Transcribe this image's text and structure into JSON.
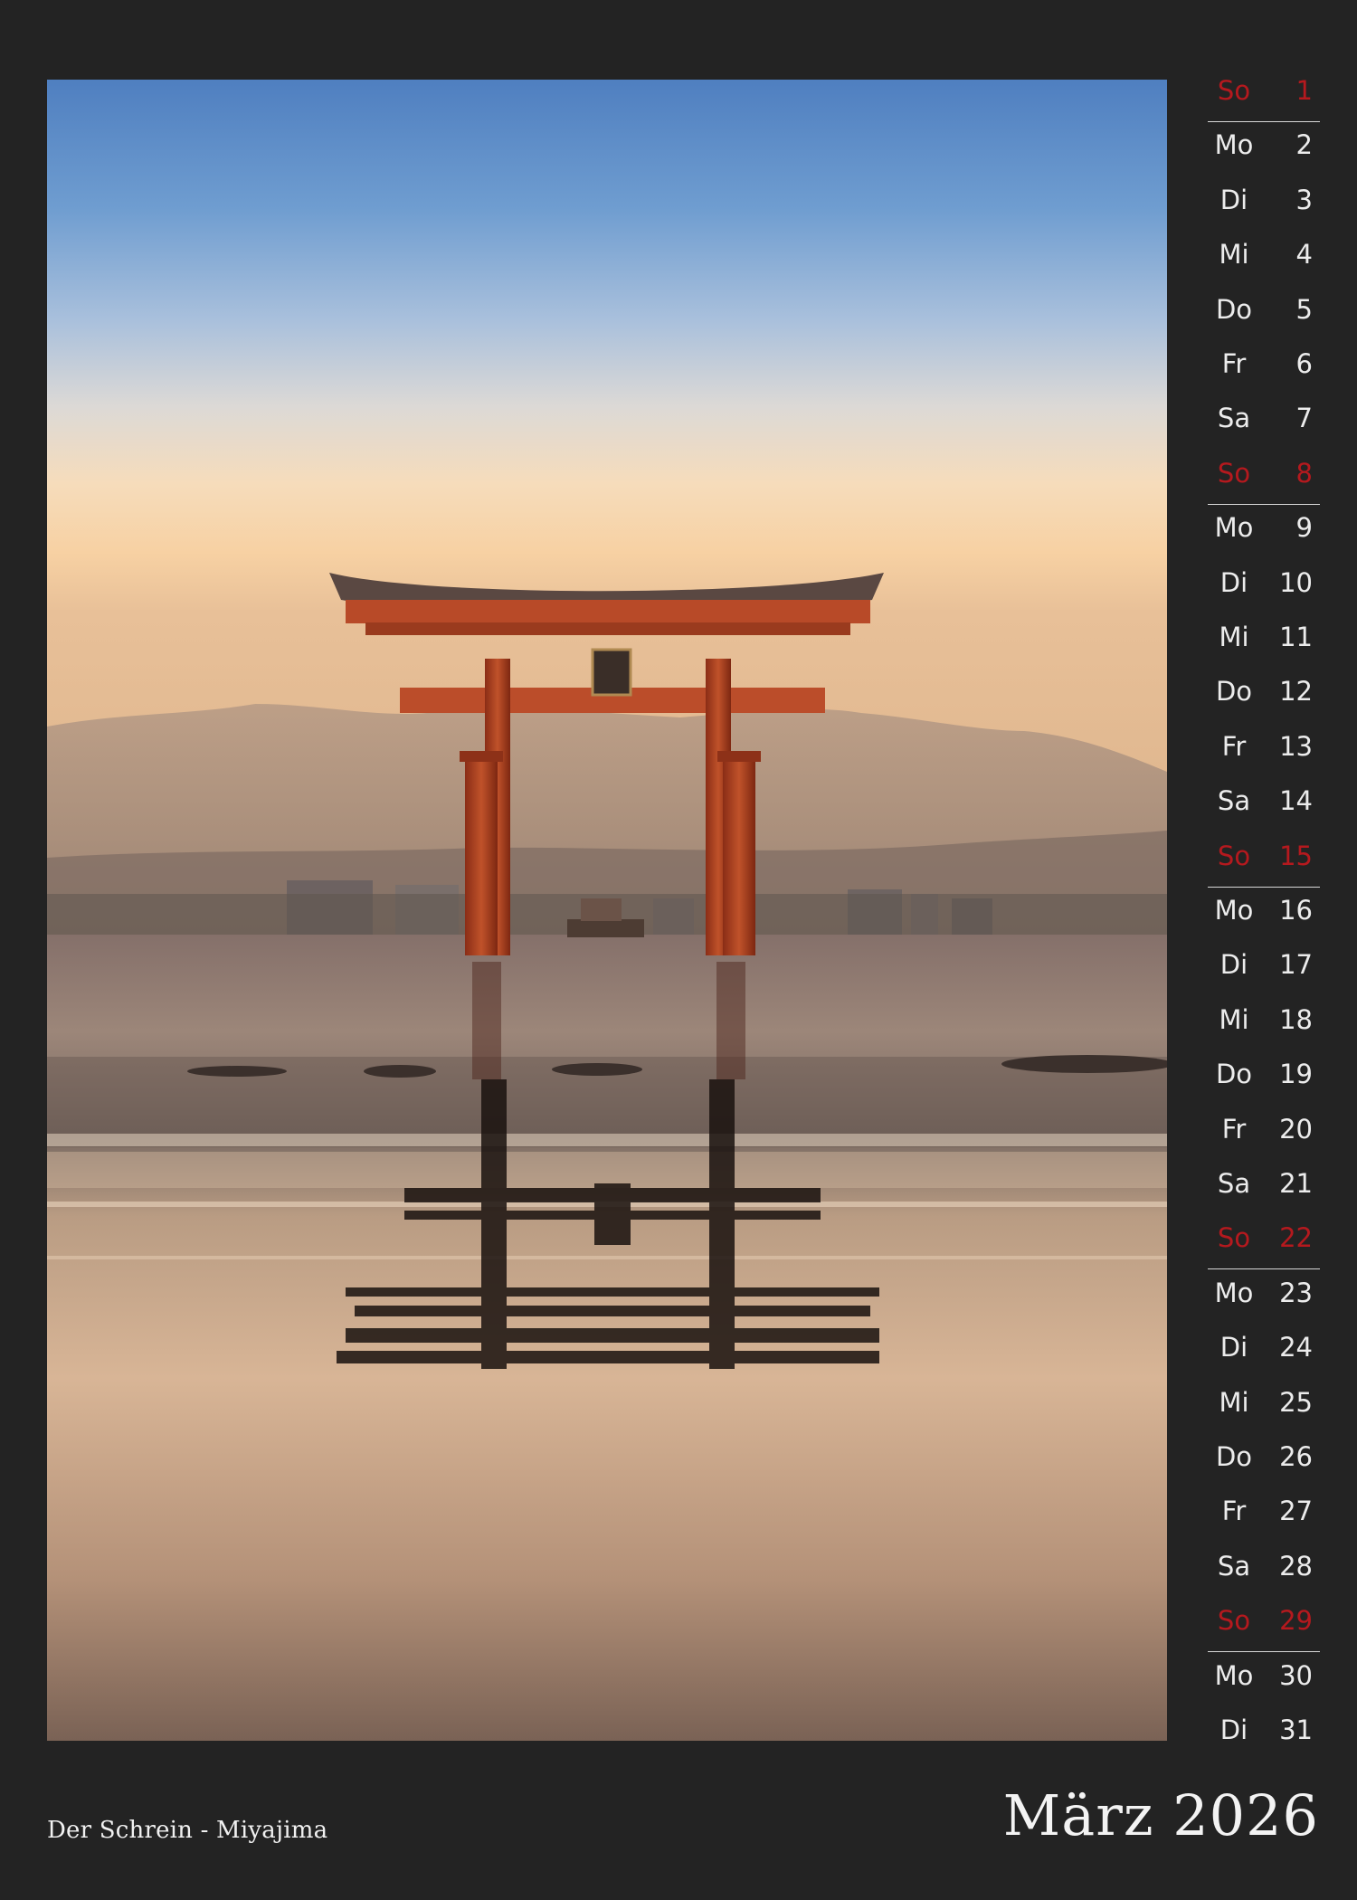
{
  "photo_caption": "Der Schrein - Miyajima",
  "month_title": "März 2026",
  "accent_color": "#b5191e",
  "days": [
    {
      "wd": "So",
      "d": "1",
      "sunday": true
    },
    {
      "wd": "Mo",
      "d": "2"
    },
    {
      "wd": "Di",
      "d": "3"
    },
    {
      "wd": "Mi",
      "d": "4"
    },
    {
      "wd": "Do",
      "d": "5"
    },
    {
      "wd": "Fr",
      "d": "6"
    },
    {
      "wd": "Sa",
      "d": "7"
    },
    {
      "wd": "So",
      "d": "8",
      "sunday": true
    },
    {
      "wd": "Mo",
      "d": "9"
    },
    {
      "wd": "Di",
      "d": "10"
    },
    {
      "wd": "Mi",
      "d": "11"
    },
    {
      "wd": "Do",
      "d": "12"
    },
    {
      "wd": "Fr",
      "d": "13"
    },
    {
      "wd": "Sa",
      "d": "14"
    },
    {
      "wd": "So",
      "d": "15",
      "sunday": true
    },
    {
      "wd": "Mo",
      "d": "16"
    },
    {
      "wd": "Di",
      "d": "17"
    },
    {
      "wd": "Mi",
      "d": "18"
    },
    {
      "wd": "Do",
      "d": "19"
    },
    {
      "wd": "Fr",
      "d": "20"
    },
    {
      "wd": "Sa",
      "d": "21"
    },
    {
      "wd": "So",
      "d": "22",
      "sunday": true
    },
    {
      "wd": "Mo",
      "d": "23"
    },
    {
      "wd": "Di",
      "d": "24"
    },
    {
      "wd": "Mi",
      "d": "25"
    },
    {
      "wd": "Do",
      "d": "26"
    },
    {
      "wd": "Fr",
      "d": "27"
    },
    {
      "wd": "Sa",
      "d": "28"
    },
    {
      "wd": "So",
      "d": "29",
      "sunday": true
    },
    {
      "wd": "Mo",
      "d": "30"
    },
    {
      "wd": "Di",
      "d": "31"
    }
  ]
}
